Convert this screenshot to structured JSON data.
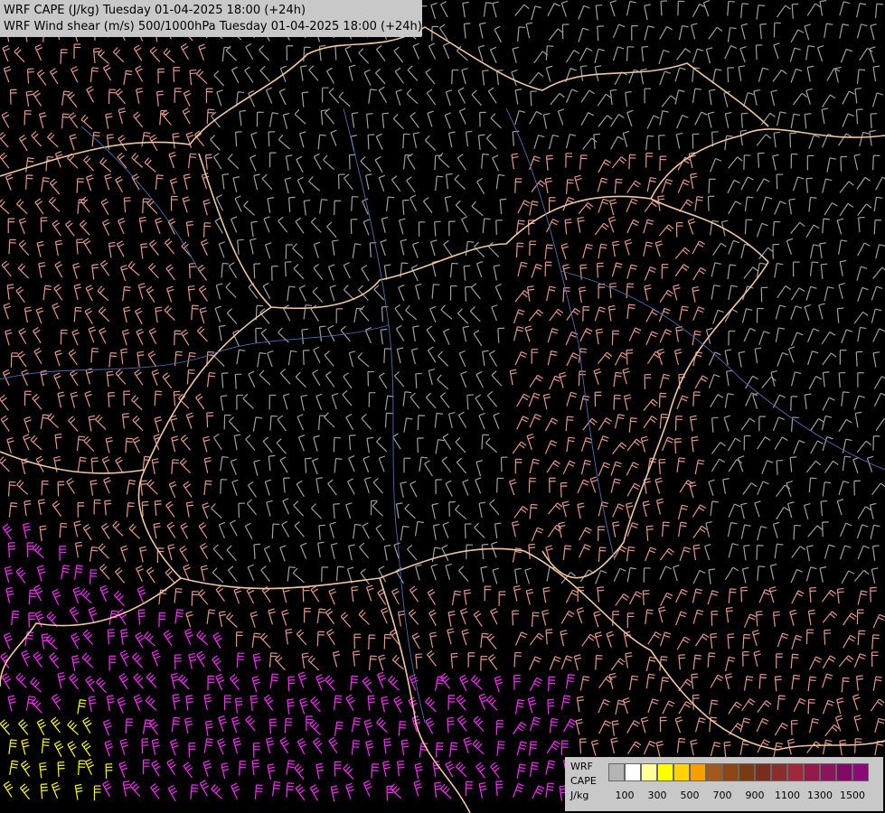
{
  "title": {
    "line1": "WRF CAPE (J/kg) Tuesday 01-04-2025 18:00 (+24h)",
    "line2": "WRF Wind shear (m/s) 500/1000hPa Tuesday 01-04-2025 18:00 (+24h)"
  },
  "legend": {
    "label1": "WRF",
    "label2": "CAPE",
    "label3": "J/kg",
    "colors": [
      "#b4b4b4",
      "#ffffff",
      "#ffff9b",
      "#ffff00",
      "#ffd200",
      "#f5a000",
      "#a05a1e",
      "#8c4614",
      "#783c14",
      "#782d1e",
      "#8c2d2d",
      "#a0283c",
      "#96194b",
      "#8c145a",
      "#820a64",
      "#8c0a78"
    ],
    "ticks": [
      "100",
      "300",
      "500",
      "700",
      "900",
      "1100",
      "1300",
      "1500"
    ]
  },
  "map": {
    "ocean_color": "#000000",
    "border_color": "#f0c8a0",
    "river_color": "#4a6fb0",
    "barb_colors": {
      "low": "#d2d2d2",
      "weak": "#a0a0a0",
      "moderate": "#e6968c",
      "strong": "#ff7878",
      "very_strong": "#ff28ff",
      "cape": "#ffff00"
    }
  }
}
